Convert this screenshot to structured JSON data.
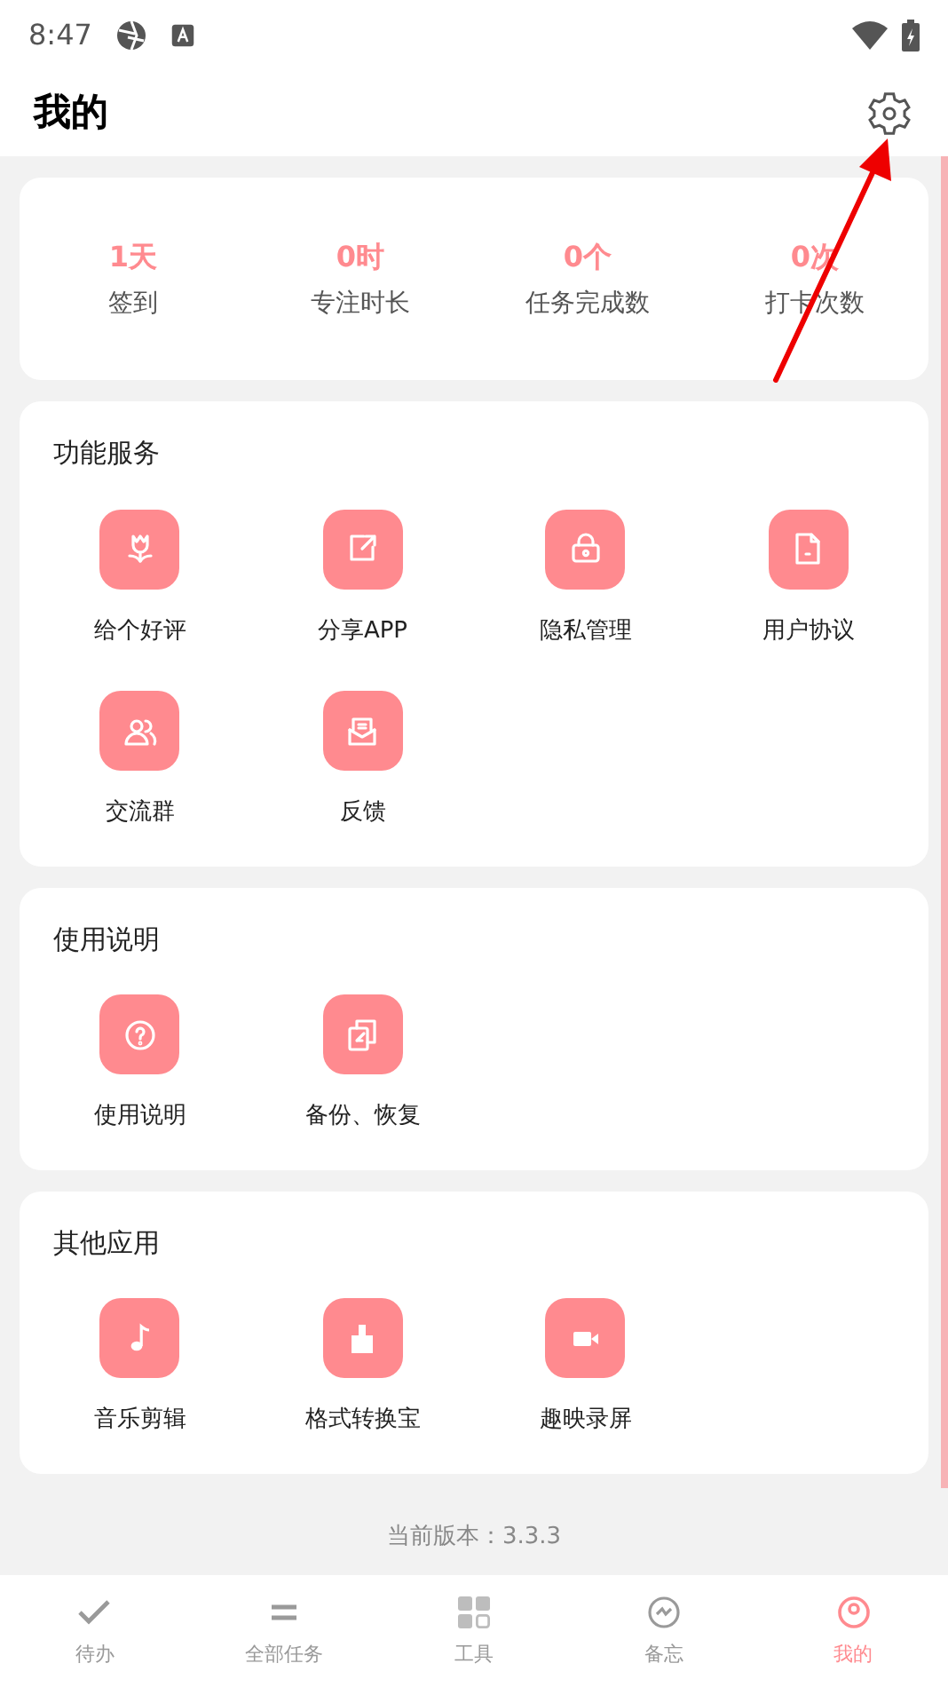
{
  "status_bar": {
    "time": "8:47"
  },
  "header": {
    "title": "我的"
  },
  "stats": [
    {
      "value": "1天",
      "label": "签到"
    },
    {
      "value": "0时",
      "label": "专注时长"
    },
    {
      "value": "0个",
      "label": "任务完成数"
    },
    {
      "value": "0次",
      "label": "打卡次数"
    }
  ],
  "sections": [
    {
      "title": "功能服务",
      "items": [
        {
          "kind": "flower",
          "label": "给个好评"
        },
        {
          "kind": "share",
          "label": "分享APP"
        },
        {
          "kind": "lock",
          "label": "隐私管理"
        },
        {
          "kind": "doc",
          "label": "用户协议"
        },
        {
          "kind": "group",
          "label": "交流群"
        },
        {
          "kind": "mail",
          "label": "反馈"
        }
      ]
    },
    {
      "title": "使用说明",
      "items": [
        {
          "kind": "help",
          "label": "使用说明"
        },
        {
          "kind": "copy",
          "label": "备份、恢复"
        }
      ]
    },
    {
      "title": "其他应用",
      "items": [
        {
          "kind": "music",
          "label": "音乐剪辑"
        },
        {
          "kind": "brush",
          "label": "格式转换宝"
        },
        {
          "kind": "video",
          "label": "趣映录屏"
        }
      ]
    }
  ],
  "version": "当前版本：3.3.3",
  "bottom_nav": [
    {
      "kind": "check",
      "label": "待办",
      "selected": false
    },
    {
      "kind": "lines",
      "label": "全部任务",
      "selected": false
    },
    {
      "kind": "grid",
      "label": "工具",
      "selected": false
    },
    {
      "kind": "memo",
      "label": "备忘",
      "selected": false
    },
    {
      "kind": "person",
      "label": "我的",
      "selected": true
    }
  ]
}
